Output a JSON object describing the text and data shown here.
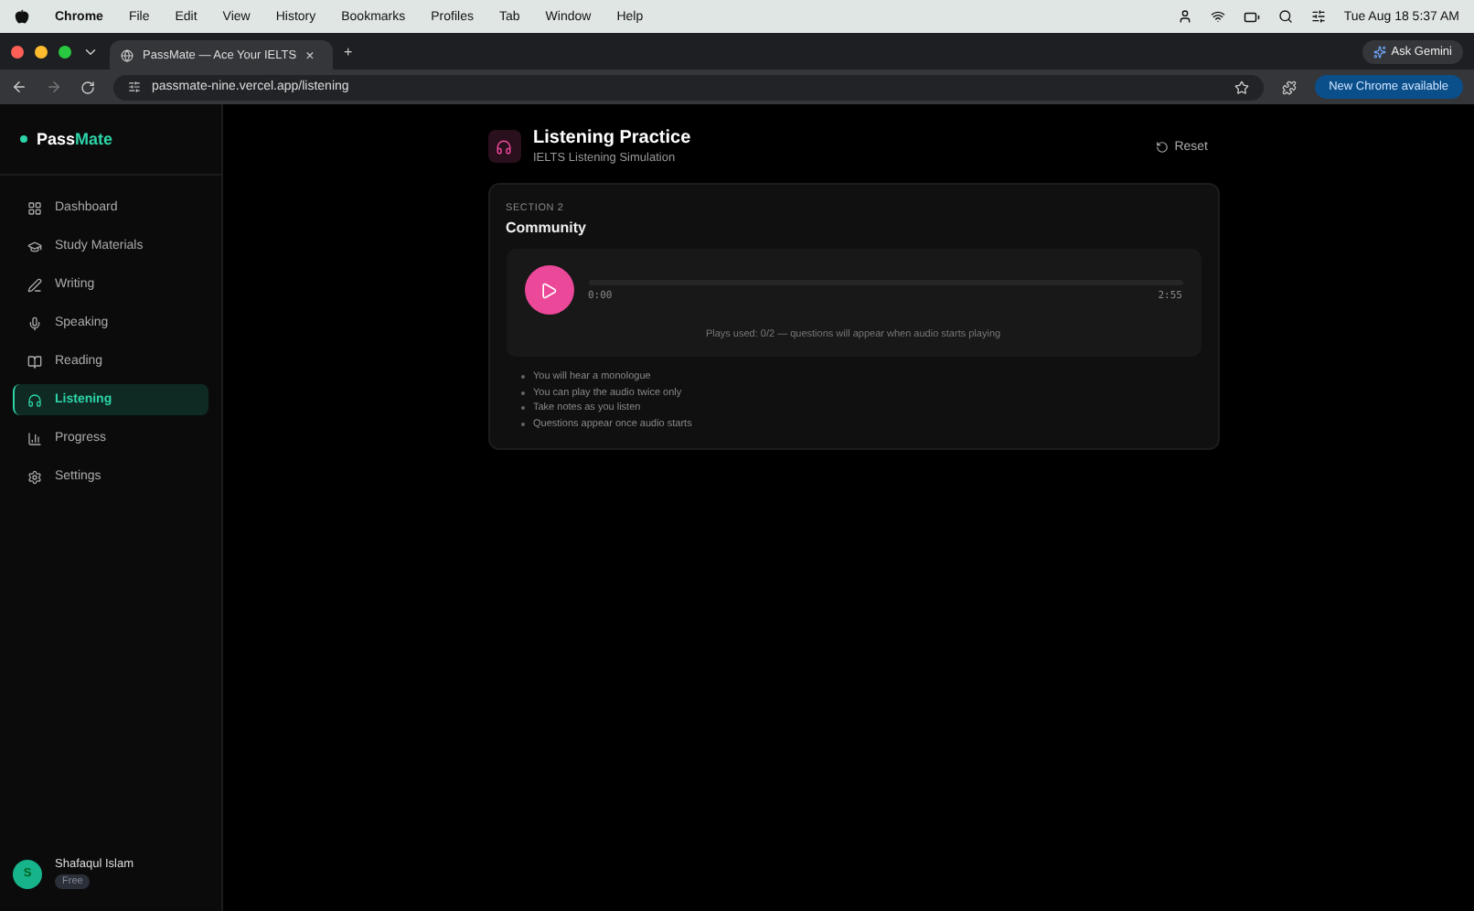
{
  "menu_bar": {
    "app": "Chrome",
    "items": [
      "File",
      "Edit",
      "View",
      "History",
      "Bookmarks",
      "Profiles",
      "Tab",
      "Window",
      "Help"
    ],
    "clock": "Tue Aug 18  5:37 AM"
  },
  "browser": {
    "tab_title": "PassMate — Ace Your IELTS",
    "tab_close": "×",
    "new_tab": "+",
    "ask_gemini": "Ask Gemini",
    "url": "passmate-nine.vercel.app/listening",
    "update_button": "New Chrome available"
  },
  "sidebar": {
    "logo": [
      "Pass",
      "Mate"
    ],
    "items": [
      {
        "label": "Dashboard",
        "selected": false
      },
      {
        "label": "Study Materials",
        "selected": false
      },
      {
        "label": "Writing",
        "selected": false
      },
      {
        "label": "Speaking",
        "selected": false
      },
      {
        "label": "Reading",
        "selected": false
      },
      {
        "label": "Listening",
        "selected": true
      },
      {
        "label": "Progress",
        "selected": false
      },
      {
        "label": "Settings",
        "selected": false
      }
    ],
    "user": {
      "initial": "S",
      "name": "Shafaqul Islam",
      "plan": "Free"
    }
  },
  "header": {
    "title": "Listening Practice",
    "subtitle": "IELTS Listening Simulation",
    "reset": "Reset"
  },
  "card": {
    "section": "SECTION 2",
    "title": "Community",
    "player": {
      "playing": false,
      "current": "0:00",
      "total": "2:55",
      "status": "Plays used: 0/2 — questions will appear when audio starts playing"
    },
    "notes": [
      "You will hear a monologue",
      "You can play the audio twice only",
      "Take notes as you listen",
      "Questions appear once audio starts"
    ]
  }
}
